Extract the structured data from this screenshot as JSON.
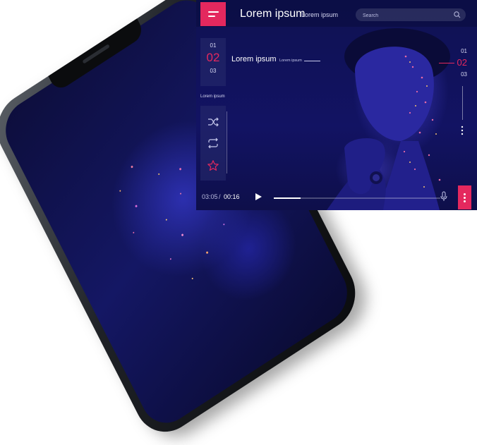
{
  "colors": {
    "accent": "#e4285e",
    "panel_bg": "#121363",
    "text_primary": "#ffffff",
    "text_muted": "#b9bbdf"
  },
  "header": {
    "title": "Lorem ipsum",
    "subtitle": "Lorem ipsum",
    "menu_icon": "hamburger-icon"
  },
  "search": {
    "placeholder": "Search",
    "icon": "search-icon"
  },
  "left_nav": {
    "numbers": [
      "01",
      "02",
      "03"
    ],
    "active_index": 1,
    "label": "Lorem ipsum"
  },
  "controls": [
    {
      "name": "shuffle-icon"
    },
    {
      "name": "repeat-icon"
    },
    {
      "name": "star-icon"
    }
  ],
  "main": {
    "title": "Lorem ipsum",
    "subtitle": "Lorem ipsum"
  },
  "right_nav": {
    "numbers": [
      "01",
      "02",
      "03"
    ],
    "active_index": 1,
    "more_icon": "vertical-dots-icon"
  },
  "player": {
    "current_time": "03:05",
    "separator": "/",
    "total_time": "00:16",
    "progress": 0.16,
    "play_icon": "play-icon",
    "mic_icon": "microphone-icon",
    "more_icon": "more-vertical-icon"
  }
}
